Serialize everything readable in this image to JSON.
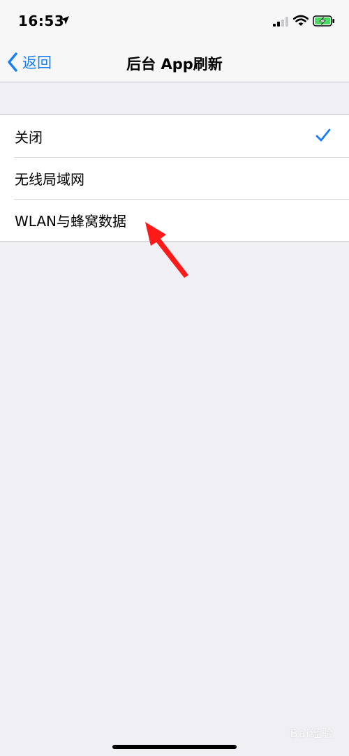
{
  "status_bar": {
    "time": "16:53"
  },
  "nav": {
    "back_label": "返回",
    "title": "后台 App刷新"
  },
  "options": [
    {
      "label": "关闭",
      "selected": true
    },
    {
      "label": "无线局域网",
      "selected": false
    },
    {
      "label": "WLAN与蜂窝数据",
      "selected": false
    }
  ],
  "watermark": "Bai经验",
  "colors": {
    "accent": "#157efb",
    "background": "#efeff4",
    "annotation_arrow": "#ff1a1a",
    "battery_charging": "#4cd964"
  },
  "icons": {
    "location": "location-arrow-icon",
    "signal": "cellular-signal-icon",
    "wifi": "wifi-icon",
    "battery": "battery-charging-icon",
    "back": "chevron-left-icon",
    "check": "checkmark-icon"
  }
}
